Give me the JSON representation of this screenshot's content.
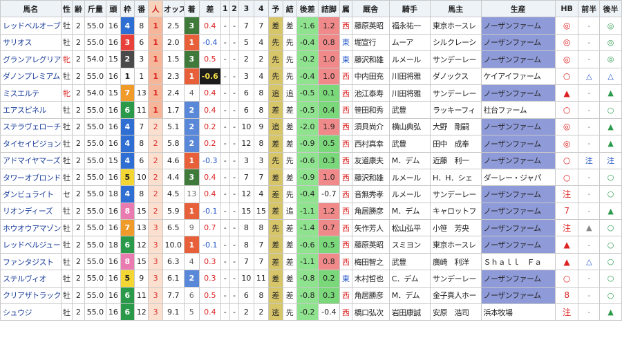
{
  "headers": [
    "馬名",
    "性",
    "齢",
    "斤量",
    "頭",
    "枠",
    "番",
    "人",
    "オッズ",
    "着",
    "差",
    "1",
    "2",
    "3",
    "4",
    "予",
    "結",
    "後差",
    "詰脚",
    "属",
    "厩舎",
    "騎手",
    "馬主",
    "生産",
    "HB",
    "前半",
    "後半"
  ],
  "rows": [
    [
      "レッドベルオーブ",
      "牡",
      "2",
      "55.0",
      "16",
      "4",
      "8",
      "1",
      "2.5",
      "3",
      "0.4",
      "-",
      "-",
      "7",
      "7",
      "差",
      "差",
      "-1.6",
      "1.2",
      "西",
      "藤原英昭",
      "福永祐一",
      "東京ホースレ",
      "ノーザンファーム",
      "◎",
      "-",
      "◎"
    ],
    [
      "サリオス",
      "牡",
      "2",
      "55.0",
      "16",
      "3",
      "6",
      "1",
      "2.0",
      "1",
      "-0.4",
      "-",
      "-",
      "5",
      "4",
      "先",
      "先",
      "-0.4",
      "0.8",
      "東",
      "堀宣行",
      "ムーア",
      "シルクレーシ",
      "ノーザンファーム",
      "◎",
      "-",
      "◎"
    ],
    [
      "グランアレグリア",
      "牝",
      "2",
      "54.0",
      "15",
      "2",
      "3",
      "1",
      "1.5",
      "3",
      "0.5",
      "-",
      "-",
      "2",
      "2",
      "先",
      "先",
      "-0.2",
      "1.0",
      "東",
      "藤沢和雄",
      "ルメール",
      "サンデーレー",
      "ノーザンファーム",
      "◎",
      "-",
      "◎"
    ],
    [
      "ダノンプレミアム",
      "牡",
      "2",
      "55.0",
      "16",
      "1",
      "1",
      "1",
      "2.3",
      "1",
      "-0.6",
      "-",
      "-",
      "3",
      "4",
      "先",
      "先",
      "-0.4",
      "1.0",
      "西",
      "中内田充",
      "川田将雅",
      "ダノックス",
      "ケイアイファーム",
      "○",
      "△",
      "△"
    ],
    [
      "ミスエルテ",
      "牝",
      "2",
      "54.0",
      "15",
      "7",
      "13",
      "1",
      "2.4",
      "4",
      "0.4",
      "-",
      "-",
      "6",
      "8",
      "追",
      "追",
      "-0.5",
      "0.1",
      "西",
      "池江泰寿",
      "川田将雅",
      "サンデーレー",
      "ノーザンファーム",
      "▲",
      "-",
      "▲"
    ],
    [
      "エアスピネル",
      "牡",
      "2",
      "55.0",
      "16",
      "6",
      "11",
      "1",
      "1.7",
      "2",
      "0.4",
      "-",
      "-",
      "6",
      "8",
      "差",
      "差",
      "-0.5",
      "0.4",
      "西",
      "笹田和秀",
      "武豊",
      "ラッキーフィ",
      "社台ファーム",
      "○",
      "-",
      "○"
    ],
    [
      "ステラヴェローチェ",
      "牡",
      "2",
      "55.0",
      "16",
      "4",
      "7",
      "2",
      "5.1",
      "2",
      "0.2",
      "-",
      "-",
      "10",
      "9",
      "追",
      "差",
      "-2.0",
      "1.9",
      "西",
      "須貝尚介",
      "横山典弘",
      "大野　剛嗣",
      "ノーザンファーム",
      "◎",
      "-",
      "▲"
    ],
    [
      "タイセイビジョン",
      "牡",
      "2",
      "55.0",
      "16",
      "4",
      "8",
      "2",
      "5.8",
      "2",
      "0.2",
      "-",
      "-",
      "12",
      "8",
      "差",
      "差",
      "-0.9",
      "0.5",
      "西",
      "西村真幸",
      "武豊",
      "田中　成奉",
      "ノーザンファーム",
      "◎",
      "-",
      "▲"
    ],
    [
      "アドマイヤマーズ",
      "牡",
      "2",
      "55.0",
      "15",
      "4",
      "6",
      "2",
      "4.6",
      "1",
      "-0.3",
      "-",
      "-",
      "3",
      "3",
      "先",
      "先",
      "-0.6",
      "0.3",
      "西",
      "友道康夫",
      "M．デム",
      "近藤　利一",
      "ノーザンファーム",
      "○",
      "注",
      "注"
    ],
    [
      "タワーオブロンドン",
      "牡",
      "2",
      "55.0",
      "16",
      "5",
      "10",
      "2",
      "4.4",
      "3",
      "0.4",
      "-",
      "-",
      "7",
      "7",
      "差",
      "差",
      "-0.9",
      "1.0",
      "西",
      "藤沢和雄",
      "ルメール",
      "H．H．シェ",
      "ダーレー・ジャパ",
      "○",
      "-",
      "○"
    ],
    [
      "ダンビュライト",
      "セ",
      "2",
      "55.0",
      "18",
      "4",
      "8",
      "2",
      "4.5",
      "13",
      "0.4",
      "-",
      "-",
      "12",
      "4",
      "差",
      "先",
      "-0.4",
      "-0.7",
      "西",
      "音無秀孝",
      "ルメール",
      "サンデーレー",
      "ノーザンファーム",
      "注",
      "-",
      "○"
    ],
    [
      "リオンディーズ",
      "牡",
      "2",
      "55.0",
      "16",
      "8",
      "15",
      "2",
      "5.9",
      "1",
      "-0.1",
      "-",
      "-",
      "15",
      "15",
      "差",
      "追",
      "-1.1",
      "1.2",
      "西",
      "角居勝彦",
      "M．デム",
      "キャロットフ",
      "ノーザンファーム",
      "7",
      "-",
      "▲"
    ],
    [
      "ホウオウアマゾン",
      "牡",
      "2",
      "55.0",
      "16",
      "7",
      "13",
      "3",
      "6.5",
      "9",
      "0.7",
      "-",
      "-",
      "8",
      "8",
      "先",
      "差",
      "-1.4",
      "0.7",
      "西",
      "矢作芳人",
      "松山弘平",
      "小笹　芳央",
      "ノーザンファーム",
      "注",
      "▲",
      "○"
    ],
    [
      "レッドベルジュール",
      "牡",
      "2",
      "55.0",
      "18",
      "6",
      "12",
      "3",
      "10.0",
      "1",
      "-0.1",
      "-",
      "-",
      "8",
      "7",
      "差",
      "差",
      "-0.6",
      "0.5",
      "西",
      "藤原英昭",
      "スミヨン",
      "東京ホースレ",
      "ノーザンファーム",
      "▲",
      "-",
      "○"
    ],
    [
      "ファンタジスト",
      "牡",
      "2",
      "55.0",
      "16",
      "8",
      "15",
      "3",
      "6.3",
      "4",
      "0.3",
      "-",
      "-",
      "7",
      "7",
      "差",
      "差",
      "-1.1",
      "0.8",
      "西",
      "梅田智之",
      "武豊",
      "廣崎　利洋",
      "Ｓｈａｌｌ　Ｆａ",
      "▲",
      "△",
      "○"
    ],
    [
      "ステルヴィオ",
      "牡",
      "2",
      "55.0",
      "16",
      "5",
      "9",
      "3",
      "6.1",
      "2",
      "0.3",
      "-",
      "-",
      "10",
      "11",
      "差",
      "差",
      "-0.8",
      "0.2",
      "東",
      "木村哲也",
      "C．デム",
      "サンデーレー",
      "ノーザンファーム",
      "○",
      "-",
      "○"
    ],
    [
      "クリアザトラック",
      "牡",
      "2",
      "55.0",
      "16",
      "6",
      "11",
      "3",
      "7.7",
      "6",
      "0.5",
      "-",
      "-",
      "6",
      "8",
      "差",
      "差",
      "-0.8",
      "0.3",
      "西",
      "角居勝彦",
      "M．デム",
      "金子真人ホー",
      "ノーザンファーム",
      "8",
      "-",
      "○"
    ],
    [
      "シュウジ",
      "牡",
      "2",
      "55.0",
      "16",
      "6",
      "12",
      "3",
      "9.1",
      "5",
      "0.4",
      "-",
      "-",
      "2",
      "2",
      "逃",
      "先",
      "-0.2",
      "-0.4",
      "西",
      "橋口弘次",
      "岩田康誠",
      "安原　浩司",
      "浜本牧場",
      "注",
      "-",
      "▲"
    ]
  ],
  "colors": {
    "header_bg": "#eef3f8",
    "popularity_bg": "#fbe0cf",
    "sire_bg": "#8f9bd8",
    "accent_red": "#d22",
    "accent_blue": "#2155c8"
  }
}
